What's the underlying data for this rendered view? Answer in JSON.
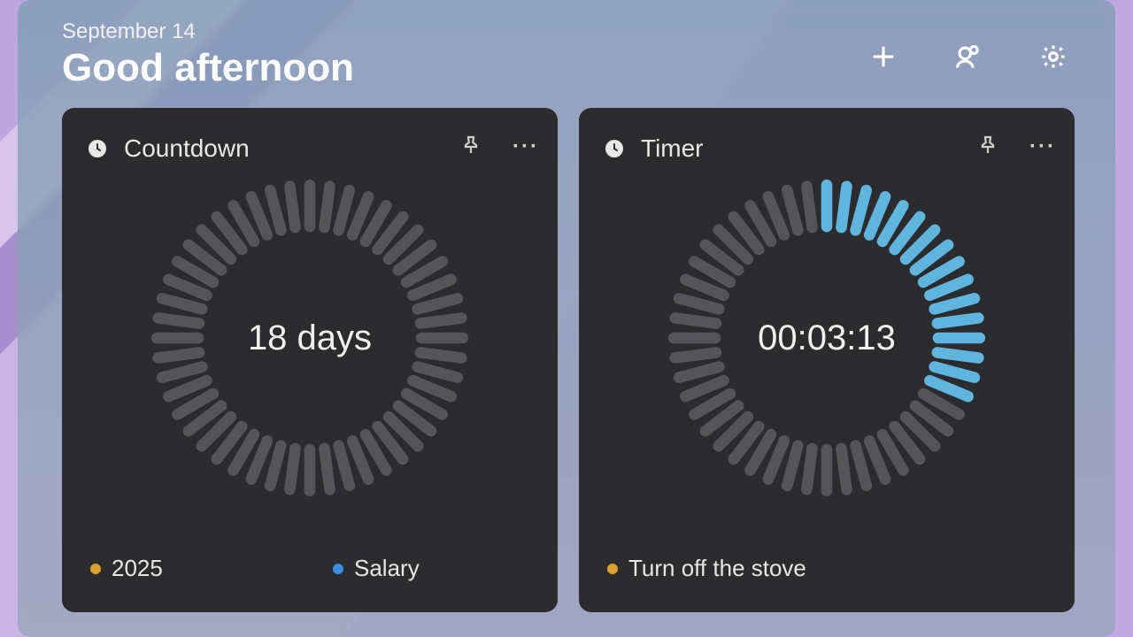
{
  "header": {
    "date": "September 14",
    "greeting": "Good afternoon"
  },
  "cards": {
    "countdown": {
      "title": "Countdown",
      "center": "18 days",
      "progress_ticks": 0,
      "total_ticks": 48,
      "tags": [
        {
          "label": "2025",
          "color": "orange"
        },
        {
          "label": "Salary",
          "color": "blue"
        }
      ]
    },
    "timer": {
      "title": "Timer",
      "center": "00:03:13",
      "progress_ticks": 16,
      "total_ticks": 48,
      "tags": [
        {
          "label": "Turn off the stove",
          "color": "orange"
        }
      ]
    }
  },
  "colors": {
    "tick_off": "#555558",
    "tick_on": "#5fb5dd"
  }
}
